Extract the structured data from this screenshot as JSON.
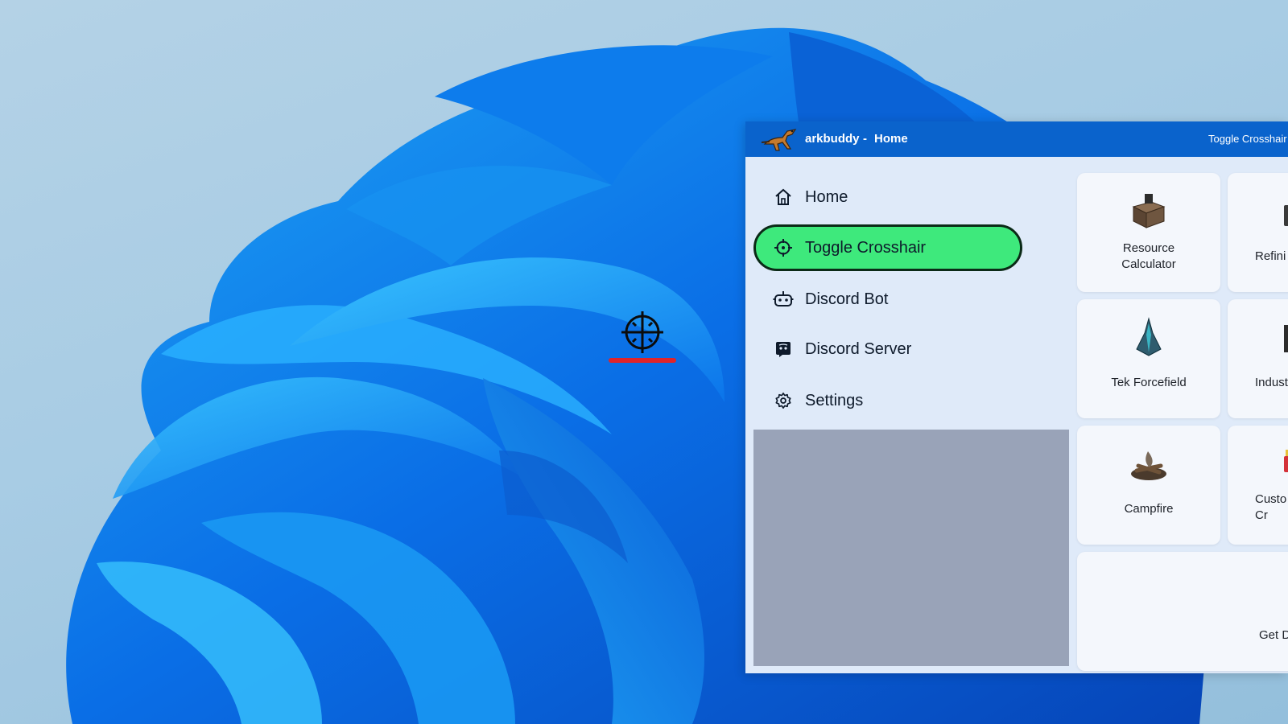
{
  "window": {
    "app_name": "arkbuddy",
    "title_separator": "-",
    "current_page": "Home",
    "title_action": "Toggle Crosshair"
  },
  "sidebar": {
    "items": [
      {
        "label": "Home",
        "icon": "home-icon",
        "active": false
      },
      {
        "label": "Toggle Crosshair",
        "icon": "crosshair-icon",
        "active": true
      },
      {
        "label": "Discord Bot",
        "icon": "robot-icon",
        "active": false
      },
      {
        "label": "Discord Server",
        "icon": "discord-icon",
        "active": false
      },
      {
        "label": "Settings",
        "icon": "gear-icon",
        "active": false
      }
    ]
  },
  "cards": [
    {
      "label": "Resource\nCalculator",
      "icon": "smithy-icon"
    },
    {
      "label": "Refini",
      "icon": "refinery-icon"
    },
    {
      "label": "Tek Forcefield",
      "icon": "tek-forcefield-icon"
    },
    {
      "label": "Indust",
      "icon": "industrial-icon"
    },
    {
      "label": "Campfire",
      "icon": "campfire-icon"
    },
    {
      "label": "Custo\nCr",
      "icon": "cooking-pot-icon"
    },
    {
      "label": "Get D",
      "icon": "dino-icon"
    }
  ],
  "colors": {
    "titlebar": "#0a63cc",
    "active_nav": "#3ee97c",
    "window_bg": "#dfeaf9",
    "crosshair_underline": "#e0242a"
  }
}
